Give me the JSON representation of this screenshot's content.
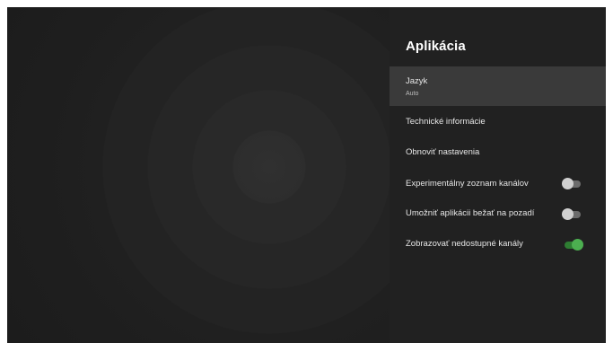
{
  "panel": {
    "title": "Aplikácia",
    "items": [
      {
        "label": "Jazyk",
        "sublabel": "Auto"
      },
      {
        "label": "Technické informácie"
      },
      {
        "label": "Obnoviť nastavenia"
      },
      {
        "label": "Experimentálny zoznam kanálov",
        "toggle": "off"
      },
      {
        "label": "Umožniť aplikácii bežať na pozadí",
        "toggle": "off"
      },
      {
        "label": "Zobrazovať nedostupné kanály",
        "toggle": "on"
      }
    ]
  },
  "colors": {
    "panel_background": "#212121",
    "selected_row": "#3a3a3a",
    "toggle_on": "#4caf50",
    "toggle_off": "#d0d0d0"
  }
}
